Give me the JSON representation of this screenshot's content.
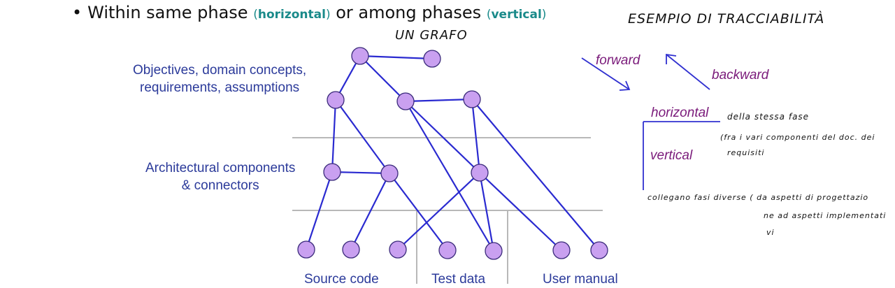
{
  "bullet": {
    "prefix": "Within same phase",
    "h_word": "horizontal",
    "middle": "or among phases",
    "v_word": "vertical"
  },
  "annotations": {
    "graph_note": "UN GRAFO",
    "title_note": "ESEMPIO DI TRACCIABILITÀ",
    "horizontal_note": "della stessa fase",
    "vertical_note_1": "(fra i vari componenti del doc. dei",
    "vertical_note_2": "requisiti",
    "bottom_note_1": "collegano fasi diverse ( da aspetti di progettazio",
    "bottom_note_2": "ne ad aspetti implementati",
    "bottom_note_3": "vi"
  },
  "layers": {
    "objectives_line1": "Objectives, domain concepts,",
    "objectives_line2": "requirements, assumptions",
    "architecture_line1": "Architectural components",
    "architecture_line2": "& connectors",
    "source_code": "Source code",
    "test_data": "Test data",
    "user_manual": "User manual"
  },
  "directions": {
    "forward": "forward",
    "backward": "backward",
    "horizontal": "horizontal",
    "vertical": "vertical"
  },
  "colors": {
    "node_fill": "#c9a0f0",
    "node_stroke": "#3a2a7a",
    "edge": "#2a2ad0",
    "separator": "#b8b8b8",
    "layer_text": "#2b3a9a",
    "direction_text": "#7a1a7a"
  },
  "graph": {
    "nodes": [
      {
        "id": "o1"
      },
      {
        "id": "o2"
      },
      {
        "id": "o3"
      },
      {
        "id": "o4"
      },
      {
        "id": "o5"
      },
      {
        "id": "a1"
      },
      {
        "id": "a2"
      },
      {
        "id": "a3"
      },
      {
        "id": "s1"
      },
      {
        "id": "s2"
      },
      {
        "id": "s3"
      },
      {
        "id": "t1"
      },
      {
        "id": "t2"
      },
      {
        "id": "u1"
      },
      {
        "id": "u2"
      }
    ],
    "edges": [
      [
        "o1",
        "o2"
      ],
      [
        "o1",
        "o3"
      ],
      [
        "o1",
        "o4"
      ],
      [
        "o4",
        "o5"
      ],
      [
        "o3",
        "a1"
      ],
      [
        "o3",
        "a2"
      ],
      [
        "a1",
        "a2"
      ],
      [
        "a1",
        "s1"
      ],
      [
        "a2",
        "s2"
      ],
      [
        "a2",
        "t1"
      ],
      [
        "o4",
        "t2"
      ],
      [
        "o4",
        "a3"
      ],
      [
        "o5",
        "a3"
      ],
      [
        "o5",
        "u2"
      ],
      [
        "a3",
        "s3"
      ],
      [
        "a3",
        "t2"
      ],
      [
        "a3",
        "u1"
      ]
    ]
  }
}
